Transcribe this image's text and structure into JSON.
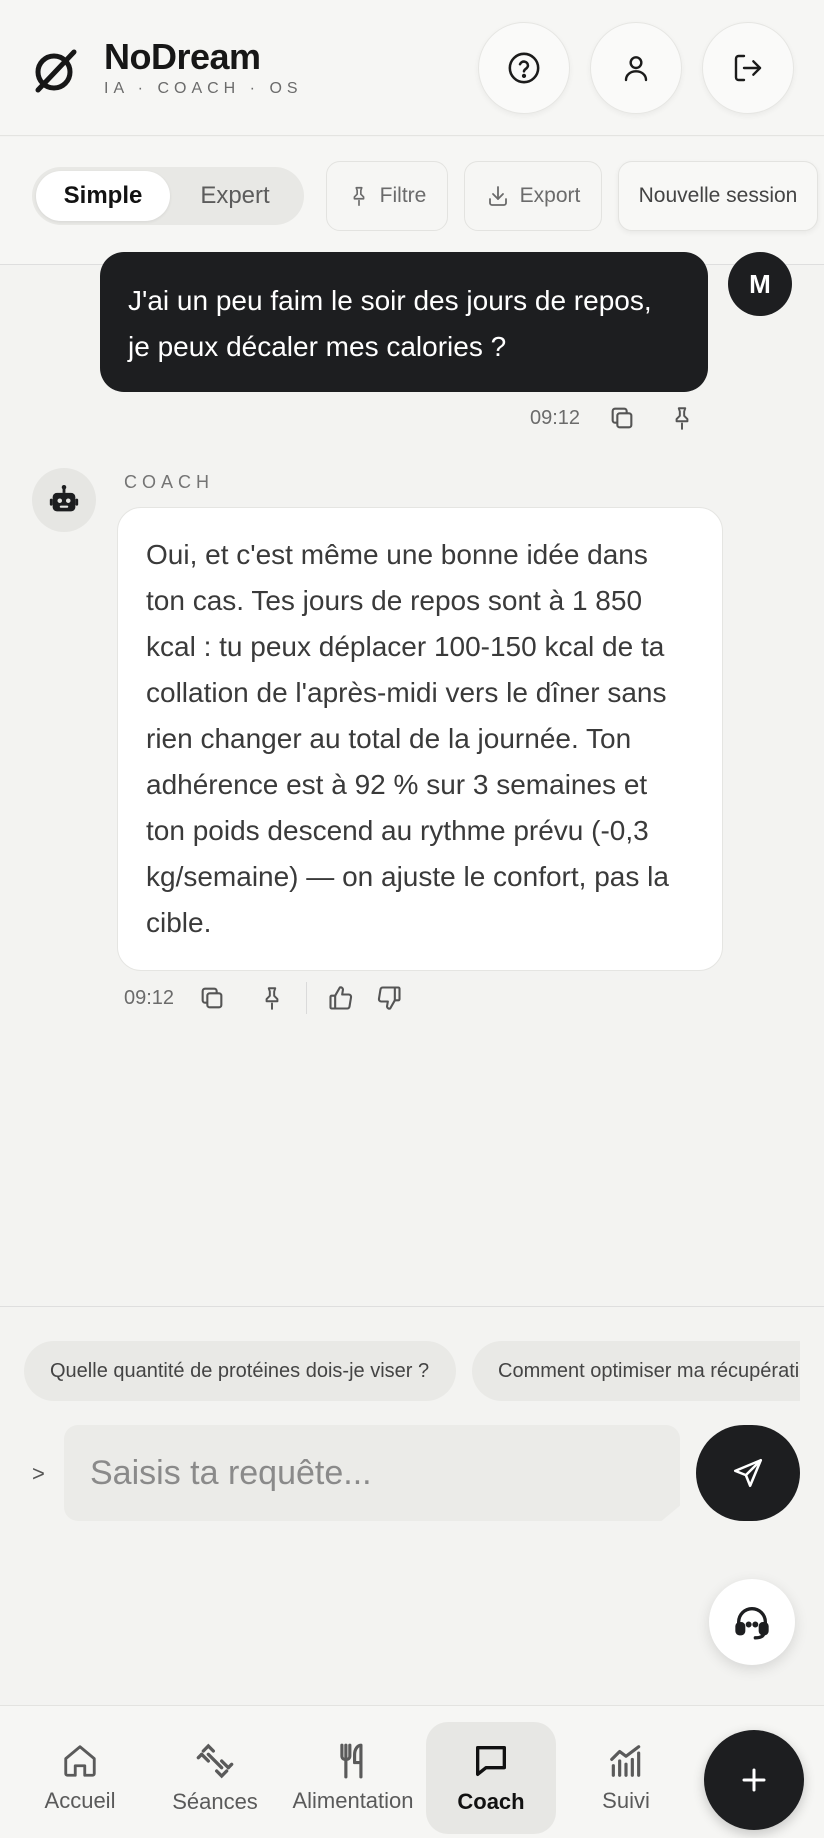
{
  "brand": {
    "name": "NoDream",
    "tagline": "IA · COACH · OS",
    "icon": "null-set-logo"
  },
  "header": {
    "buttons": [
      {
        "icon": "help-icon"
      },
      {
        "icon": "user-icon"
      },
      {
        "icon": "logout-icon"
      }
    ]
  },
  "toolbar": {
    "modes": {
      "active": "Simple",
      "inactive": "Expert"
    },
    "filter_label": "Filtre",
    "export_label": "Export",
    "new_session_label": "Nouvelle session"
  },
  "conversation": {
    "user_avatar": "M",
    "user_message": {
      "line1": "J'ai un peu faim le soir des jours de repos,",
      "line2": "je peux décaler mes calories ?",
      "time": "09:12"
    },
    "coach_label": "COACH",
    "coach_message": {
      "lines": [
        "Oui, et c'est même une bonne idée dans",
        "ton cas. Tes jours de repos sont à 1 850",
        "kcal : tu peux déplacer 100-150 kcal de ta",
        "collation de l'après-midi vers le dîner sans",
        "rien changer au total de la journée. Ton",
        "adhérence est à 92 % sur 3 semaines et",
        "ton poids descend au rythme prévu (-0,3",
        "kg/semaine) — on ajuste le confort, pas la",
        "cible."
      ],
      "time": "09:12"
    }
  },
  "suggestions": [
    "Quelle quantité de protéines dois-je viser ?",
    "Comment optimiser ma récupération"
  ],
  "composer": {
    "prompt_symbol": ">",
    "placeholder": "Saisis ta requête..."
  },
  "nav": {
    "items": [
      {
        "label": "Accueil",
        "icon": "home-icon"
      },
      {
        "label": "Séances",
        "icon": "dumbbell-icon"
      },
      {
        "label": "Alimentation",
        "icon": "utensils-icon"
      },
      {
        "label": "Coach",
        "icon": "chat-icon",
        "active": true
      },
      {
        "label": "Suivi",
        "icon": "chart-icon"
      }
    ]
  },
  "colors": {
    "background": "#f3f3f1",
    "dark": "#1d1e20",
    "bubble": "#ffffff",
    "muted": "#6b6b6b"
  }
}
